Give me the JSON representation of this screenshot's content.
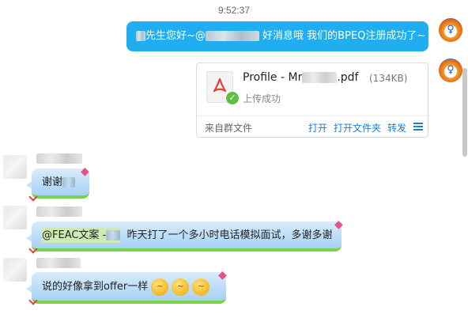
{
  "chat": {
    "timestamp": "9:52:37",
    "outgoing_text": {
      "part1": "先生您好~@",
      "part2": "好消息哦 我们的BPEQ注册成功了~"
    },
    "file_card": {
      "name_prefix": "Profile - Mr",
      "name_suffix": ".pdf",
      "size": "(134KB)",
      "status": "上传成功",
      "source": "来自群文件",
      "actions": {
        "open": "打开",
        "open_folder": "打开文件夹",
        "forward": "转发"
      }
    },
    "incoming": [
      {
        "text_prefix": "谢谢",
        "text_suffix": ""
      },
      {
        "mention": "@FEAC文案 -",
        "text": "昨天打了一个多小时电话模拟面试，多谢多谢"
      },
      {
        "text": "说的好像拿到offer一样"
      }
    ]
  },
  "icons": {
    "pdf": "pdf-icon",
    "check": "check-badge-icon",
    "menu": "menu-icon",
    "kite": "kite-icon",
    "emoji": "drooling-face-emoji"
  },
  "colors": {
    "outgoing_bubble": "#21aef0",
    "incoming_bubble": "#b9dcf7",
    "incoming_border": "#7ad24d",
    "link": "#1a7fd4"
  }
}
